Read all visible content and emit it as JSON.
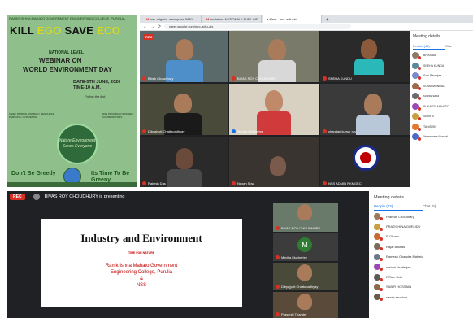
{
  "poster": {
    "header": "RAMKRISHNA MAHATO GOVERNMENT ENGINEERING COLLEGE, PURULIA",
    "kill": "KILL",
    "ego": "EGO",
    "save": "SAVE",
    "eco": "ECO",
    "national": "NATIONAL LEVEL",
    "webinar": "WEBINAR ON",
    "world_env": "WORLD ENVIRONMENT DAY",
    "date": "DATE-5TH JUNE, 2020",
    "time": "TIME-10 A.M.",
    "follow": "Follow the link",
    "left_col": "CHIEF PATRON / PATRON / RESOURCE PERSONS / CONVENOR",
    "right_col": "NSS PROGRAM OFFICER / COORDINATORS",
    "circle_text": "Nature Environment Saves Everyone",
    "dont": "Don't Be Greedy",
    "its": "Its Time To Be Greeny"
  },
  "browser": {
    "tabs": [
      {
        "label": "mrc-adgmh - sambpase 5830..."
      },
      {
        "label": "Invitation: NATIONAL LEVEL WE..."
      },
      {
        "label": "Meet - mrc-adfu-ais"
      }
    ],
    "url": "meet.google.com/mrc-adfu-ais",
    "rec": "REC",
    "tiles": [
      {
        "name": "Bibek Chowdhury"
      },
      {
        "name": "BIVAS ROY CHOUDHURY"
      },
      {
        "name": "SNEHA KUNDU"
      },
      {
        "name": "Dibyajyoti Chattopadhyay"
      },
      {
        "name": "Medha Mukherjee"
      },
      {
        "name": "chandan kumar ray"
      },
      {
        "name": "Rakesh Das"
      },
      {
        "name": "Nayan Sow"
      },
      {
        "name": "NSS ADMIN RKMGEC"
      }
    ],
    "panel_title": "Meeting details",
    "people_tab": "People (45)",
    "chat_tab": "Cha",
    "people": [
      "BIVAS Adj",
      "SNEHA KUNDU",
      "Som Banerjee",
      "SOMA MONDAL",
      "sourav saha",
      "SUKANTA MAHATO",
      "Sumit M",
      "TANIS SK",
      "Yeasmnara Mondal"
    ]
  },
  "bottom": {
    "rec": "REC",
    "presenting": "BIVAS ROY CHOUDHURY is presenting",
    "slide_title": "Industry and Environment",
    "slide_sub": "TIME FOR NATURE",
    "slide_inst_1": "Ramkrishna Mahato Government",
    "slide_inst_2": "Engineering College, Purulia",
    "slide_inst_3": "&",
    "slide_inst_4": "NSS",
    "tiles": [
      {
        "name": "BIVAS ROY CHOUDHURY"
      },
      {
        "name": "Medha Mukherjee"
      },
      {
        "name": "Dibyajyoti Chattopadhyay"
      },
      {
        "name": "Prasenjit Thander"
      }
    ],
    "tile_initial": "M",
    "panel_title": "Meeting details",
    "people_tab": "People (43)",
    "chat_tab": "Chat (5)",
    "people": [
      "Prabhat Choudhary",
      "PRATICHINA GURUDU",
      "R Ghosh",
      "Rajat Biswas",
      "Ramesh Chandra Mahato",
      "reshmi chatterjee",
      "RiTam Dutt",
      "SABIR HOSSAIN",
      "samip ranchun"
    ]
  },
  "colors": {
    "meet_bg": "#202124",
    "rec_red": "#d93025",
    "poster_green": "#8fbf8a",
    "accent_blue": "#1a73e8"
  }
}
